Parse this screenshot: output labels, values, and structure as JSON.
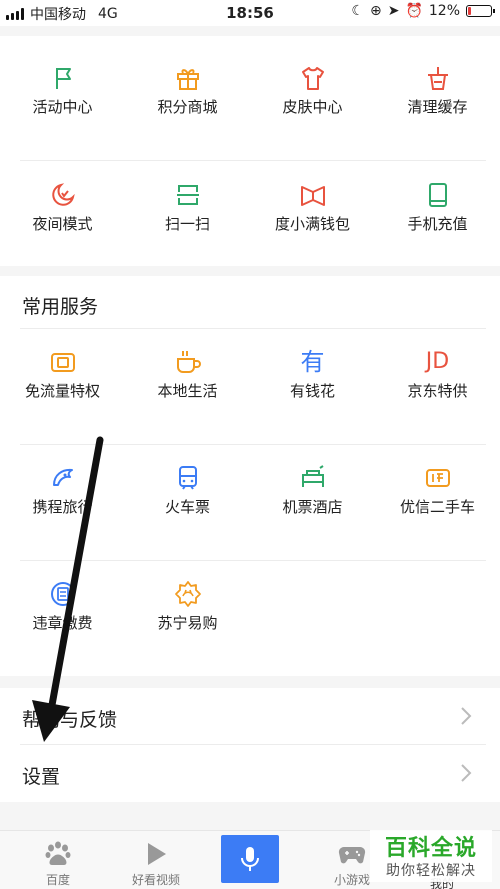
{
  "status_bar": {
    "carrier": "中国移动",
    "network": "4G",
    "time": "18:56",
    "battery": "12%",
    "battery_level": 0.12
  },
  "grid_top": {
    "row1": [
      {
        "label": "活动中心",
        "icon": "flag-icon",
        "color": "#2fa86a"
      },
      {
        "label": "积分商城",
        "icon": "gift-icon",
        "color": "#f29b1f"
      },
      {
        "label": "皮肤中心",
        "icon": "tshirt-icon",
        "color": "#e8533f"
      },
      {
        "label": "清理缓存",
        "icon": "broom-basket-icon",
        "color": "#e8533f"
      }
    ],
    "row2": [
      {
        "label": "夜间模式",
        "icon": "moon-icon",
        "color": "#e8533f"
      },
      {
        "label": "扫一扫",
        "icon": "scan-icon",
        "color": "#2fa86a"
      },
      {
        "label": "度小满钱包",
        "icon": "wallet-book-icon",
        "color": "#e8533f"
      },
      {
        "label": "手机充值",
        "icon": "phone-book-icon",
        "color": "#2fa86a"
      }
    ]
  },
  "services": {
    "title": "常用服务",
    "row1": [
      {
        "label": "免流量特权",
        "icon": "data-card-icon",
        "color": "#f29b1f"
      },
      {
        "label": "本地生活",
        "icon": "cup-icon",
        "color": "#f29b1f"
      },
      {
        "label": "有钱花",
        "icon": "money-char-icon",
        "color": "#3c7cf5",
        "glyph": "有"
      },
      {
        "label": "京东特供",
        "icon": "jd-icon",
        "color": "#e8533f",
        "glyph": "JD"
      }
    ],
    "row2": [
      {
        "label": "携程旅行",
        "icon": "dolphin-icon",
        "color": "#3c7cf5"
      },
      {
        "label": "火车票",
        "icon": "train-icon",
        "color": "#3c7cf5"
      },
      {
        "label": "机票酒店",
        "icon": "bed-icon",
        "color": "#2fa86a"
      },
      {
        "label": "优信二手车",
        "icon": "used-car-icon",
        "color": "#f29b1f"
      }
    ],
    "row3": [
      {
        "label": "违章缴费",
        "icon": "ticket-icon",
        "color": "#3c7cf5"
      },
      {
        "label": "苏宁易购",
        "icon": "suning-icon",
        "color": "#f29b1f"
      }
    ]
  },
  "list": {
    "help": "帮助与反馈",
    "settings": "设置"
  },
  "tabbar": {
    "home": "百度",
    "video": "好看视频",
    "games": "小游戏",
    "mine": "我的"
  },
  "watermark": {
    "title": "百科全说",
    "subtitle": "助你轻松解决"
  }
}
